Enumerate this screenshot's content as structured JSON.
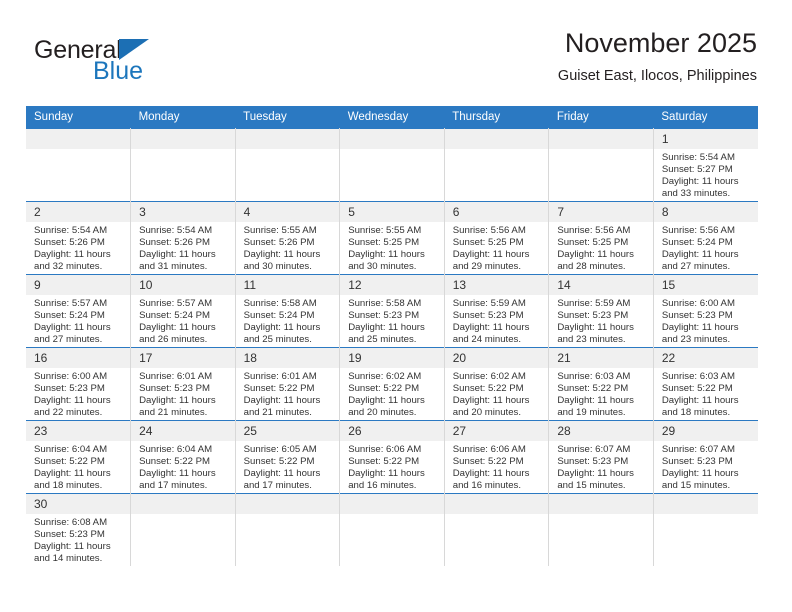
{
  "logo": {
    "word_top": "General",
    "word_bottom": "Blue",
    "flag_icon": "triangle-flag-icon",
    "color_black": "#231f20",
    "color_blue": "#1c76bc"
  },
  "header": {
    "title": "November 2025",
    "subtitle": "Guiset East, Ilocos, Philippines"
  },
  "colors": {
    "header_blue": "#2b79c2",
    "daynum_band": "#f0f0f0",
    "text": "#333333"
  },
  "calendar": {
    "weekdays": [
      "Sunday",
      "Monday",
      "Tuesday",
      "Wednesday",
      "Thursday",
      "Friday",
      "Saturday"
    ],
    "labels": {
      "sunrise": "Sunrise:",
      "sunset": "Sunset:",
      "daylight": "Daylight:"
    },
    "weeks": [
      [
        {
          "day": "",
          "lines": []
        },
        {
          "day": "",
          "lines": []
        },
        {
          "day": "",
          "lines": []
        },
        {
          "day": "",
          "lines": []
        },
        {
          "day": "",
          "lines": []
        },
        {
          "day": "",
          "lines": []
        },
        {
          "day": "1",
          "lines": [
            "Sunrise: 5:54 AM",
            "Sunset: 5:27 PM",
            "Daylight: 11 hours and 33 minutes."
          ]
        }
      ],
      [
        {
          "day": "2",
          "lines": [
            "Sunrise: 5:54 AM",
            "Sunset: 5:26 PM",
            "Daylight: 11 hours and 32 minutes."
          ]
        },
        {
          "day": "3",
          "lines": [
            "Sunrise: 5:54 AM",
            "Sunset: 5:26 PM",
            "Daylight: 11 hours and 31 minutes."
          ]
        },
        {
          "day": "4",
          "lines": [
            "Sunrise: 5:55 AM",
            "Sunset: 5:26 PM",
            "Daylight: 11 hours and 30 minutes."
          ]
        },
        {
          "day": "5",
          "lines": [
            "Sunrise: 5:55 AM",
            "Sunset: 5:25 PM",
            "Daylight: 11 hours and 30 minutes."
          ]
        },
        {
          "day": "6",
          "lines": [
            "Sunrise: 5:56 AM",
            "Sunset: 5:25 PM",
            "Daylight: 11 hours and 29 minutes."
          ]
        },
        {
          "day": "7",
          "lines": [
            "Sunrise: 5:56 AM",
            "Sunset: 5:25 PM",
            "Daylight: 11 hours and 28 minutes."
          ]
        },
        {
          "day": "8",
          "lines": [
            "Sunrise: 5:56 AM",
            "Sunset: 5:24 PM",
            "Daylight: 11 hours and 27 minutes."
          ]
        }
      ],
      [
        {
          "day": "9",
          "lines": [
            "Sunrise: 5:57 AM",
            "Sunset: 5:24 PM",
            "Daylight: 11 hours and 27 minutes."
          ]
        },
        {
          "day": "10",
          "lines": [
            "Sunrise: 5:57 AM",
            "Sunset: 5:24 PM",
            "Daylight: 11 hours and 26 minutes."
          ]
        },
        {
          "day": "11",
          "lines": [
            "Sunrise: 5:58 AM",
            "Sunset: 5:24 PM",
            "Daylight: 11 hours and 25 minutes."
          ]
        },
        {
          "day": "12",
          "lines": [
            "Sunrise: 5:58 AM",
            "Sunset: 5:23 PM",
            "Daylight: 11 hours and 25 minutes."
          ]
        },
        {
          "day": "13",
          "lines": [
            "Sunrise: 5:59 AM",
            "Sunset: 5:23 PM",
            "Daylight: 11 hours and 24 minutes."
          ]
        },
        {
          "day": "14",
          "lines": [
            "Sunrise: 5:59 AM",
            "Sunset: 5:23 PM",
            "Daylight: 11 hours and 23 minutes."
          ]
        },
        {
          "day": "15",
          "lines": [
            "Sunrise: 6:00 AM",
            "Sunset: 5:23 PM",
            "Daylight: 11 hours and 23 minutes."
          ]
        }
      ],
      [
        {
          "day": "16",
          "lines": [
            "Sunrise: 6:00 AM",
            "Sunset: 5:23 PM",
            "Daylight: 11 hours and 22 minutes."
          ]
        },
        {
          "day": "17",
          "lines": [
            "Sunrise: 6:01 AM",
            "Sunset: 5:23 PM",
            "Daylight: 11 hours and 21 minutes."
          ]
        },
        {
          "day": "18",
          "lines": [
            "Sunrise: 6:01 AM",
            "Sunset: 5:22 PM",
            "Daylight: 11 hours and 21 minutes."
          ]
        },
        {
          "day": "19",
          "lines": [
            "Sunrise: 6:02 AM",
            "Sunset: 5:22 PM",
            "Daylight: 11 hours and 20 minutes."
          ]
        },
        {
          "day": "20",
          "lines": [
            "Sunrise: 6:02 AM",
            "Sunset: 5:22 PM",
            "Daylight: 11 hours and 20 minutes."
          ]
        },
        {
          "day": "21",
          "lines": [
            "Sunrise: 6:03 AM",
            "Sunset: 5:22 PM",
            "Daylight: 11 hours and 19 minutes."
          ]
        },
        {
          "day": "22",
          "lines": [
            "Sunrise: 6:03 AM",
            "Sunset: 5:22 PM",
            "Daylight: 11 hours and 18 minutes."
          ]
        }
      ],
      [
        {
          "day": "23",
          "lines": [
            "Sunrise: 6:04 AM",
            "Sunset: 5:22 PM",
            "Daylight: 11 hours and 18 minutes."
          ]
        },
        {
          "day": "24",
          "lines": [
            "Sunrise: 6:04 AM",
            "Sunset: 5:22 PM",
            "Daylight: 11 hours and 17 minutes."
          ]
        },
        {
          "day": "25",
          "lines": [
            "Sunrise: 6:05 AM",
            "Sunset: 5:22 PM",
            "Daylight: 11 hours and 17 minutes."
          ]
        },
        {
          "day": "26",
          "lines": [
            "Sunrise: 6:06 AM",
            "Sunset: 5:22 PM",
            "Daylight: 11 hours and 16 minutes."
          ]
        },
        {
          "day": "27",
          "lines": [
            "Sunrise: 6:06 AM",
            "Sunset: 5:22 PM",
            "Daylight: 11 hours and 16 minutes."
          ]
        },
        {
          "day": "28",
          "lines": [
            "Sunrise: 6:07 AM",
            "Sunset: 5:23 PM",
            "Daylight: 11 hours and 15 minutes."
          ]
        },
        {
          "day": "29",
          "lines": [
            "Sunrise: 6:07 AM",
            "Sunset: 5:23 PM",
            "Daylight: 11 hours and 15 minutes."
          ]
        }
      ],
      [
        {
          "day": "30",
          "lines": [
            "Sunrise: 6:08 AM",
            "Sunset: 5:23 PM",
            "Daylight: 11 hours and 14 minutes."
          ]
        },
        {
          "day": "",
          "lines": []
        },
        {
          "day": "",
          "lines": []
        },
        {
          "day": "",
          "lines": []
        },
        {
          "day": "",
          "lines": []
        },
        {
          "day": "",
          "lines": []
        },
        {
          "day": "",
          "lines": []
        }
      ]
    ]
  }
}
